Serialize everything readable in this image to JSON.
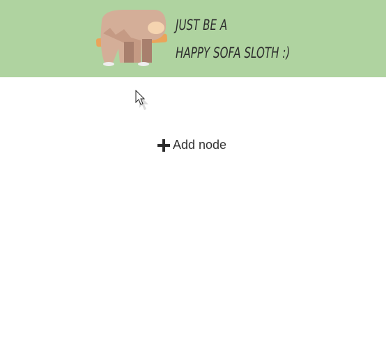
{
  "header": {
    "tagline_line1": "JUST BE A",
    "tagline_line2": "HAPPY SOFA SLOTH :)",
    "background_color": "#afd3a0"
  },
  "main": {
    "add_node_label": "Add node",
    "add_node_icon": "plus-icon"
  }
}
